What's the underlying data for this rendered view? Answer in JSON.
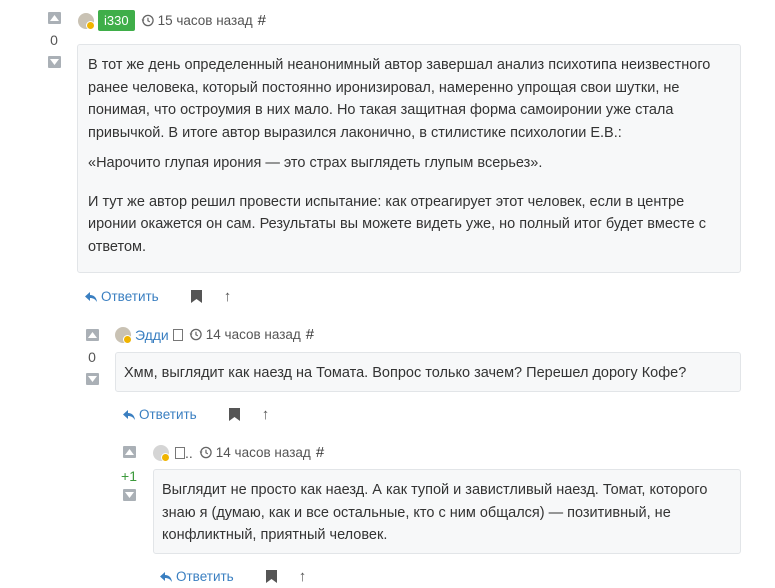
{
  "comments": [
    {
      "vote": "0",
      "author": "i330",
      "time": "15 часов назад",
      "hash": "#",
      "paragraphs": [
        "В тот же день определенный неанонимный автор завершал анализ психотипа неизвестного ранее человека, который постоянно иронизировал, намеренно упрощая свои шутки, не понимая, что остроумия в них мало. Но такая защитная форма самоиронии уже стала привычкой. В итоге автор выразился лаконично, в стилистике психологии Е.В.:",
        "«Нарочито глупая ирония — это страх выглядеть глупым всерьез».",
        "И тут же автор решил провести испытание: как отреагирует этот человек, если в центре иронии окажется он сам. Результаты вы можете видеть уже, но полный итог будет вместе с ответом."
      ],
      "reply_label": "Ответить",
      "up_label": "↑"
    },
    {
      "vote": "0",
      "author": "Эдди",
      "time": "14 часов назад",
      "hash": "#",
      "paragraphs": [
        "Хмм, выглядит как наезд на Томата. Вопрос только зачем? Перешел дорогу Кофе?"
      ],
      "reply_label": "Ответить",
      "up_label": "↑"
    },
    {
      "vote": "+1",
      "author": "..",
      "time": "14 часов назад",
      "hash": "#",
      "paragraphs": [
        "Выглядит не просто как наезд. А как тупой и завистливый наезд. Томат, которого знаю я (думаю, как и все остальные, кто с ним общался) — позитивный, не конфликтный, приятный человек."
      ],
      "reply_label": "Ответить",
      "up_label": "↑"
    }
  ],
  "colors": {
    "author_badge": "#3fae49",
    "link": "#3a7fc1",
    "positive_vote": "#3c9a3c",
    "box_bg": "#f7f8f9"
  },
  "icons": [
    "arrow-up-icon",
    "arrow-down-icon",
    "history-icon",
    "reply-icon",
    "bookmark-icon"
  ]
}
